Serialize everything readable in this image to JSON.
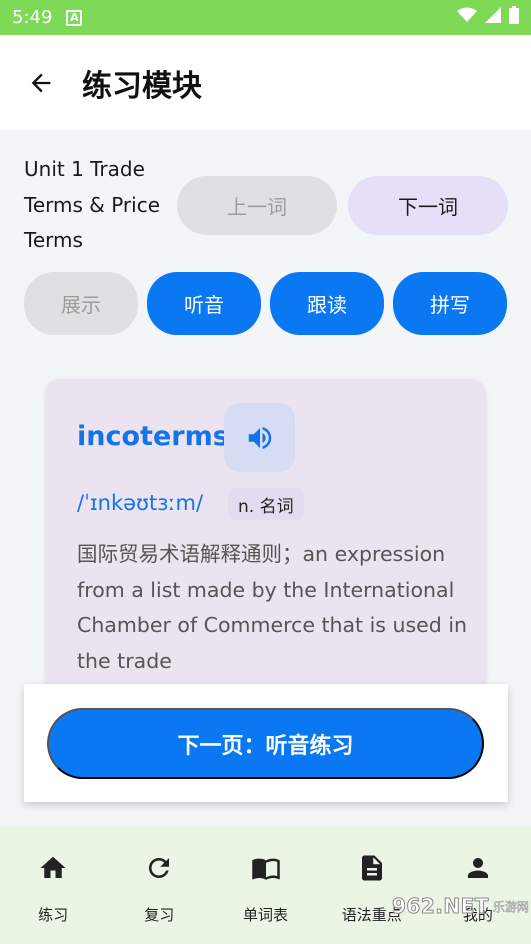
{
  "status_bar": {
    "time": "5:49",
    "notification_icon": "a-icon",
    "wifi_icon": "wifi-icon",
    "signal_icon": "signal-icon",
    "battery_icon": "battery-icon",
    "background_color": "#7ed957"
  },
  "header": {
    "title": "练习模块",
    "back_icon": "arrow-left-icon"
  },
  "unit": {
    "title": "Unit 1 Trade Terms & Price Terms"
  },
  "nav_buttons": {
    "prev_label": "上一词",
    "next_label": "下一词"
  },
  "modes": [
    {
      "label": "展示",
      "active": false
    },
    {
      "label": "听音",
      "active": true
    },
    {
      "label": "跟读",
      "active": true
    },
    {
      "label": "拼写",
      "active": true
    }
  ],
  "card": {
    "word": "incoterms",
    "speaker_icon": "volume-icon",
    "phonetic": "/ˈɪnkəʊtɜːm/",
    "pos": "n. 名词",
    "definition": "国际贸易术语解释通则；an expression from a list made by the International Chamber of Commerce that is used in the trade"
  },
  "bottom_action": {
    "label": "下一页：听音练习"
  },
  "bottom_nav": {
    "items": [
      {
        "label": "练习",
        "icon": "home-icon"
      },
      {
        "label": "复习",
        "icon": "refresh-icon"
      },
      {
        "label": "单词表",
        "icon": "book-icon"
      },
      {
        "label": "语法重点",
        "icon": "document-icon"
      },
      {
        "label": "我的",
        "icon": "person-icon"
      }
    ]
  },
  "watermark": {
    "text": "962.NET",
    "subtext": "乐游网"
  },
  "colors": {
    "primary": "#0a78f2",
    "word_blue": "#1274e8",
    "card_background": "#ebe3ef",
    "disabled_gray": "#dfe0e2",
    "next_button_lavender": "#e5e0f7",
    "nav_background": "#eaf5e6"
  }
}
